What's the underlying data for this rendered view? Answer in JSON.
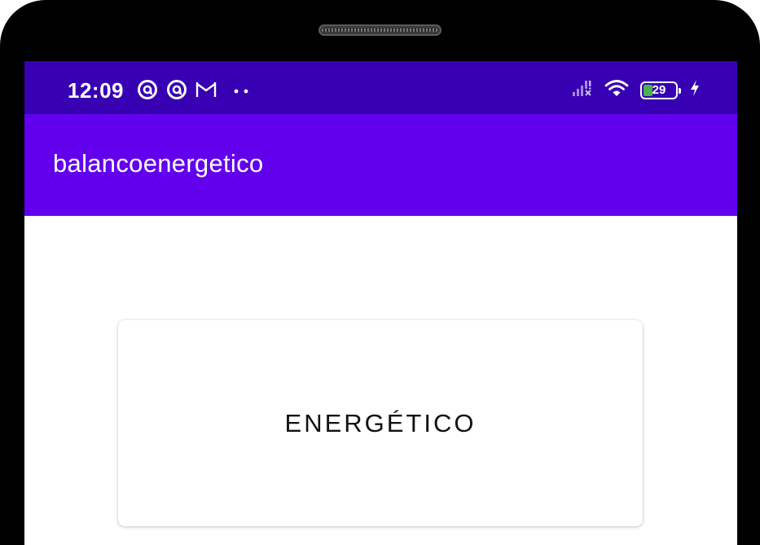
{
  "status_bar": {
    "time": "12:09",
    "battery_level": "29",
    "battery_fraction": 0.29,
    "left_icons": [
      "at-sign-icon",
      "at-sign-icon",
      "gmail-icon",
      "more-dots-icon"
    ],
    "right_icons": [
      "cellular-signal-icon",
      "wifi-icon",
      "battery-icon",
      "charging-bolt-icon"
    ]
  },
  "app_bar": {
    "title": "balancoenergetico"
  },
  "main": {
    "card_label": "ENERGÉTICO"
  },
  "colors": {
    "status_bar": "#3700b3",
    "app_bar": "#6200ee",
    "battery_fill": "#4caf50",
    "device_frame": "#000000"
  }
}
